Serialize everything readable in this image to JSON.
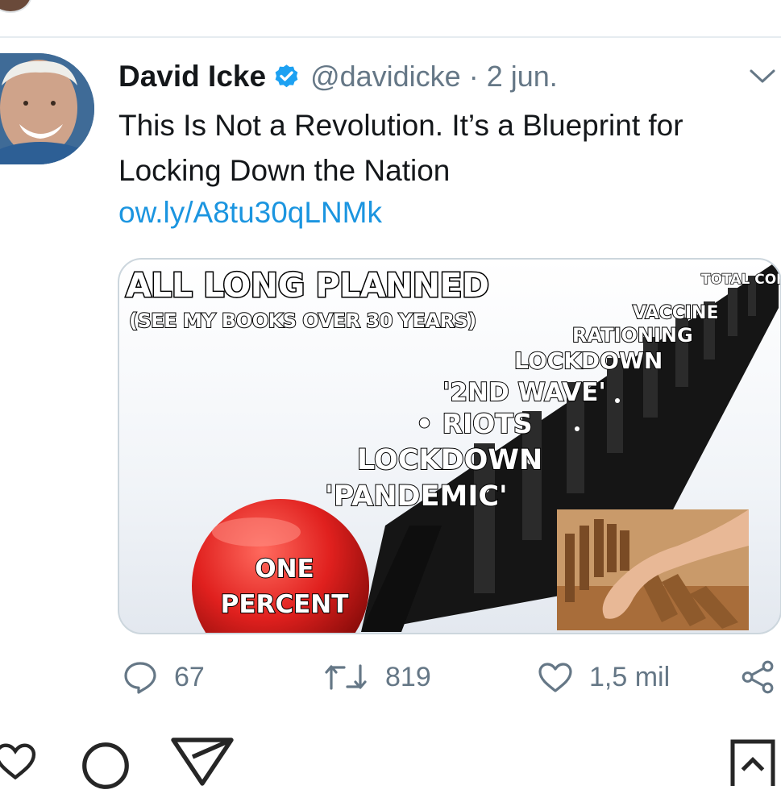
{
  "tweet": {
    "author_name": "David Icke",
    "handle": "@davidicke",
    "separator": "·",
    "date": "2 jun.",
    "text": "This Is Not a Revolution. It’s a Blueprint for Locking Down the Nation",
    "link": "ow.ly/A8tu30qLNMk",
    "verified": true
  },
  "media": {
    "headline": "ALL LONG PLANNED",
    "subline": "(SEE MY BOOKS OVER 30 YEARS)",
    "dominoes": [
      "TOTAL CONTROL",
      "VACCINE",
      "RATIONING",
      "LOCKDOWN",
      "'2ND WAVE'",
      "• RIOTS",
      "LOCKDOWN",
      "'PANDEMIC'"
    ],
    "button_line1": "ONE",
    "button_line2": "PERCENT"
  },
  "actions": {
    "replies": "67",
    "retweets": "819",
    "likes": "1,5 mil"
  },
  "colors": {
    "link": "#1b95e0",
    "verified": "#1da1f2",
    "secondary_text": "#657786",
    "button_red": "#e0201e"
  },
  "icons": {
    "reply": "reply-icon",
    "retweet": "retweet-icon",
    "like": "heart-icon",
    "share": "share-icon",
    "caret": "chevron-down-icon"
  }
}
